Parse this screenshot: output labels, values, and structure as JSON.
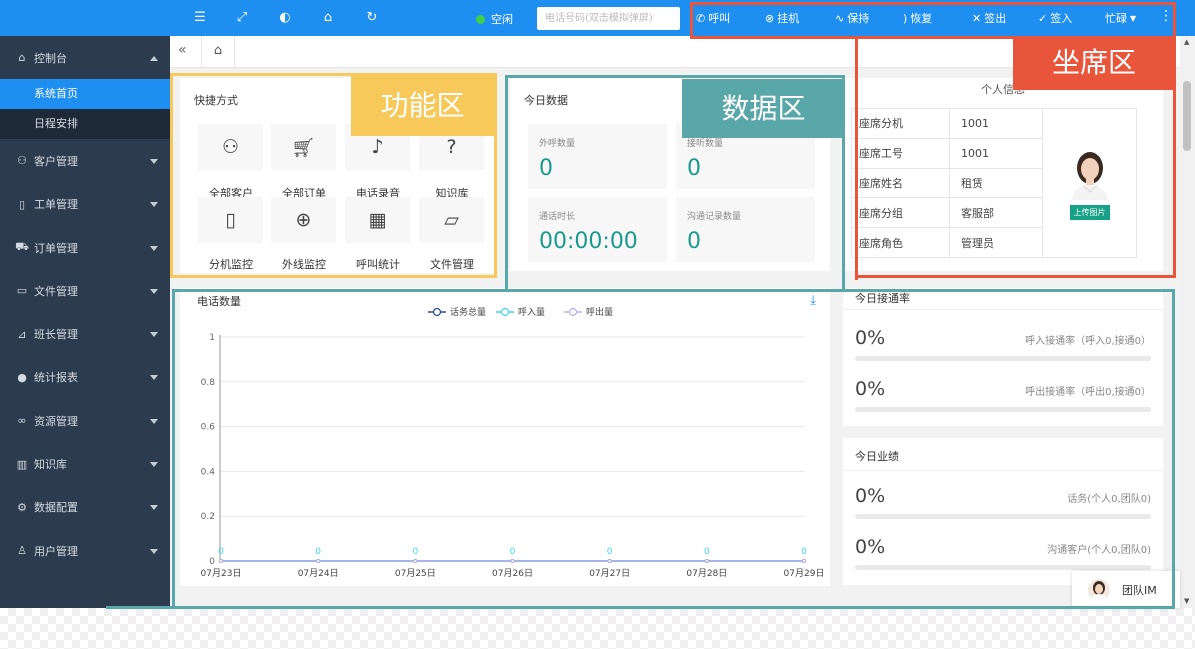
{
  "topbar": {
    "status_label": "空闲",
    "phone_placeholder": "电话号码(双击模拟弹屏)",
    "buttons": {
      "call": "呼叫",
      "hangup": "挂机",
      "hold": "保持",
      "resume": "恢复",
      "signout": "签出",
      "signin": "签入",
      "busy": "忙碌"
    }
  },
  "sidebar": {
    "items": [
      {
        "label": "控制台",
        "icon": "home-icon"
      },
      {
        "label": "客户管理",
        "icon": "user-icon"
      },
      {
        "label": "工单管理",
        "icon": "ticket-icon"
      },
      {
        "label": "订单管理",
        "icon": "cart-icon"
      },
      {
        "label": "文件管理",
        "icon": "file-icon"
      },
      {
        "label": "班长管理",
        "icon": "chart-icon"
      },
      {
        "label": "统计报表",
        "icon": "chat-icon"
      },
      {
        "label": "资源管理",
        "icon": "link-icon"
      },
      {
        "label": "知识库",
        "icon": "book-icon"
      },
      {
        "label": "数据配置",
        "icon": "gear-icon"
      },
      {
        "label": "用户管理",
        "icon": "person-icon"
      }
    ],
    "sub_items": [
      "系统首页",
      "日程安排"
    ]
  },
  "shortcuts": {
    "title": "快捷方式",
    "items": [
      "全部客户",
      "全部订单",
      "电话录音",
      "知识库",
      "分机监控",
      "外线监控",
      "呼叫统计",
      "文件管理"
    ]
  },
  "today_data": {
    "title": "今日数据",
    "stats": [
      {
        "label": "外呼数量",
        "value": "0"
      },
      {
        "label": "接听数量",
        "value": "0"
      },
      {
        "label": "通话时长",
        "value": "00:00:00"
      },
      {
        "label": "沟通记录数量",
        "value": "0"
      }
    ]
  },
  "personal_info": {
    "title": "个人信息",
    "rows": [
      {
        "key": "座席分机",
        "value": "1001"
      },
      {
        "key": "座席工号",
        "value": "1001"
      },
      {
        "key": "座席姓名",
        "value": "租赁"
      },
      {
        "key": "座席分组",
        "value": "客服部"
      },
      {
        "key": "座席角色",
        "value": "管理员"
      }
    ],
    "upload_label": "上传图片"
  },
  "call_chart": {
    "title": "电话数量"
  },
  "chart_data": {
    "type": "line",
    "title": "电话数量",
    "xlabel": "",
    "ylabel": "",
    "categories": [
      "07月23日",
      "07月24日",
      "07月25日",
      "07月26日",
      "07月27日",
      "07月28日",
      "07月29日"
    ],
    "series": [
      {
        "name": "话务总量",
        "values": [
          0,
          0,
          0,
          0,
          0,
          0,
          0
        ],
        "color": "#2b4a8a"
      },
      {
        "name": "呼入量",
        "values": [
          0,
          0,
          0,
          0,
          0,
          0,
          0
        ],
        "color": "#43d6f0"
      },
      {
        "name": "呼出量",
        "values": [
          0,
          0,
          0,
          0,
          0,
          0,
          0
        ],
        "color": "#b9b2ef"
      }
    ],
    "yticks": [
      "0",
      "0.2",
      "0.4",
      "0.6",
      "0.8",
      "1"
    ],
    "ylim": [
      0,
      1
    ],
    "grid": true,
    "legend": "top-center",
    "point_labels": [
      "0",
      "0",
      "0",
      "0",
      "0",
      "0",
      "0"
    ]
  },
  "connect_rate": {
    "title": "今日接通率",
    "rows": [
      {
        "value": "0%",
        "desc": "呼入接通率（呼入0,接通0）",
        "progress": 0
      },
      {
        "value": "0%",
        "desc": "呼出接通率（呼出0,接通0）",
        "progress": 0
      }
    ]
  },
  "performance": {
    "title": "今日业绩",
    "rows": [
      {
        "value": "0%",
        "desc": "话务(个人0,团队0)",
        "progress": 0
      },
      {
        "value": "0%",
        "desc": "沟通客户(个人0,团队0)",
        "progress": 0
      }
    ]
  },
  "im": {
    "label": "团队IM"
  },
  "zones": {
    "seat": "坐席区",
    "function": "功能区",
    "data": "数据区"
  },
  "colors": {
    "primary": "#1e8ff0",
    "sidebar": "#2d3b4e",
    "teal": "#1a9a8e",
    "zone_seat": "#e8553a",
    "zone_function": "#f7c85a",
    "zone_data": "#5aa7aa"
  }
}
